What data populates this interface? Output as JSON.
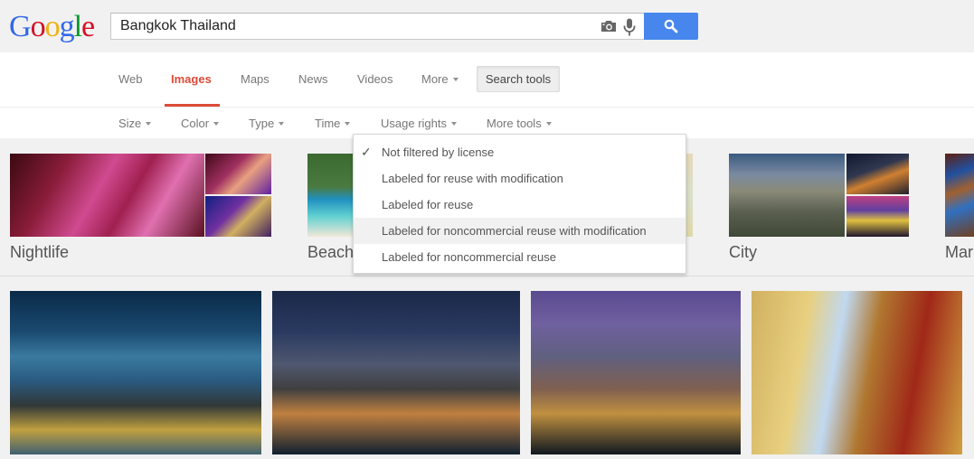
{
  "logo": {
    "letters": [
      {
        "char": "G",
        "color": "#3369e8"
      },
      {
        "char": "o",
        "color": "#d50f25"
      },
      {
        "char": "o",
        "color": "#eeb211"
      },
      {
        "char": "g",
        "color": "#3369e8"
      },
      {
        "char": "l",
        "color": "#009925"
      },
      {
        "char": "e",
        "color": "#d50f25"
      }
    ]
  },
  "search": {
    "query": "Bangkok Thailand",
    "camera_icon": "camera-icon",
    "mic_icon": "microphone-icon",
    "button_icon": "search-icon",
    "button_color": "#4787ed"
  },
  "nav": {
    "tabs": [
      {
        "label": "Web",
        "active": false
      },
      {
        "label": "Images",
        "active": true
      },
      {
        "label": "Maps",
        "active": false
      },
      {
        "label": "News",
        "active": false
      },
      {
        "label": "Videos",
        "active": false
      },
      {
        "label": "More",
        "active": false,
        "dropdown": true
      }
    ],
    "search_tools_label": "Search tools",
    "active_color": "#dd4b39"
  },
  "tools": {
    "items": [
      {
        "label": "Size"
      },
      {
        "label": "Color"
      },
      {
        "label": "Type"
      },
      {
        "label": "Time"
      },
      {
        "label": "Usage rights"
      },
      {
        "label": "More tools"
      }
    ]
  },
  "usage_rights_menu": {
    "items": [
      {
        "label": "Not filtered by license",
        "checked": true,
        "hovered": false
      },
      {
        "label": "Labeled for reuse with modification",
        "checked": false,
        "hovered": false
      },
      {
        "label": "Labeled for reuse",
        "checked": false,
        "hovered": false
      },
      {
        "label": "Labeled for noncommercial reuse with modification",
        "checked": false,
        "hovered": true
      },
      {
        "label": "Labeled for noncommercial reuse",
        "checked": false,
        "hovered": false
      }
    ],
    "check_icon": "checkmark-icon"
  },
  "collections": [
    {
      "label": "Nightlife"
    },
    {
      "label": "Beach"
    },
    {
      "label": "City"
    },
    {
      "label": "Mar"
    }
  ],
  "results": [
    {
      "alt": "Bangkok skyline at night with river"
    },
    {
      "alt": "Bangkok city night view with bridge"
    },
    {
      "alt": "Bangkok skyline at dusk"
    },
    {
      "alt": "Grand Palace temple spires"
    }
  ]
}
